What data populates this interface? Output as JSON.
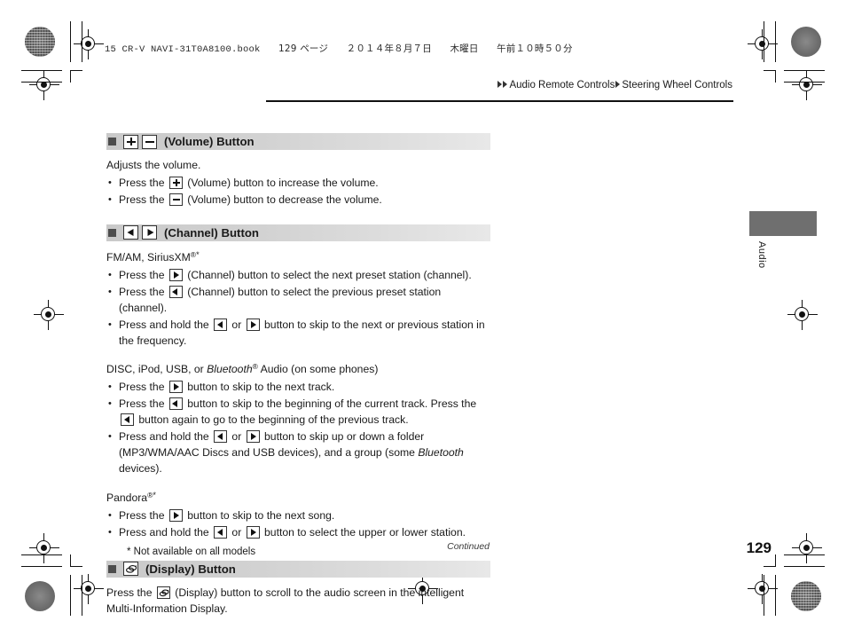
{
  "print_slug": {
    "text": "15 CR-V NAVI-31T0A8100.book",
    "page_label": "129 ページ",
    "date": "２０１４年８月７日",
    "weekday": "木曜日",
    "time": "午前１０時５０分"
  },
  "breadcrumb": {
    "parent": "Audio Remote Controls",
    "current": "Steering Wheel Controls"
  },
  "sections": [
    {
      "title": "(Volume) Button",
      "icons": [
        "plus-key-icon",
        "minus-key-icon"
      ],
      "intro": "Adjusts the volume.",
      "bullets": [
        {
          "before": "Press the ",
          "icon": "plus",
          "after": " (Volume) button to increase the volume."
        },
        {
          "before": "Press the ",
          "icon": "minus",
          "after": " (Volume) button to decrease the volume."
        }
      ]
    },
    {
      "title": "(Channel) Button",
      "icons": [
        "left-arrow-key-icon",
        "right-arrow-key-icon"
      ],
      "groups": [
        {
          "heading": "FM/AM, SiriusXM®*",
          "heading_base": "FM/AM, SiriusXM",
          "bullets": [
            "Press the [right] (Channel) button to select the next preset station (channel).",
            "Press the [left] (Channel) button to select the previous preset station (channel).",
            "Press and hold the [left] or [right] button to skip to the next or previous station in the frequency."
          ]
        },
        {
          "heading": "DISC, iPod, USB, or Bluetooth® Audio (on some phones)",
          "bullets": [
            "Press the [right] button to skip to the next track.",
            "Press the [left] button to skip to the beginning of the current track. Press the [left] button again to go to the beginning of the previous track.",
            "Press and hold the [left] or [right] button to skip up or down a folder (MP3/WMA/AAC Discs and USB devices), and a group (some Bluetooth devices)."
          ]
        },
        {
          "heading": "Pandora®*",
          "heading_base": "Pandora",
          "bullets": [
            "Press the [right] button to skip to the next song.",
            "Press and hold the [left] or [right] button to select the upper or lower station."
          ]
        }
      ]
    },
    {
      "title": "(Display) Button",
      "icons": [
        "display-key-icon"
      ],
      "body": "Press the [display] (Display) button to scroll to the audio screen in the intelligent Multi-Information Display."
    }
  ],
  "text": {
    "disc_heading_p1": "DISC, iPod, USB, or ",
    "disc_heading_bt": "Bluetooth",
    "disc_heading_p2": " Audio (on some phones)",
    "fmam_heading": "FM/AM, SiriusXM",
    "pandora_heading": "Pandora",
    "reg_mark": "®",
    "asterisk": "*",
    "press_the": "Press the ",
    "press_and_hold_the": "Press and hold the ",
    "or": " or ",
    "vol_increase": " (Volume) button to increase the volume.",
    "vol_decrease": " (Volume) button to decrease the volume.",
    "ch_next_preset": " (Channel) button to select the next preset station (channel).",
    "ch_prev_preset": " (Channel) button to select the previous preset station (channel).",
    "ch_skip_freq": " button to skip to the next or previous station in the frequency.",
    "disc_next_track": " button to skip to the next track.",
    "disc_cur_track_a": " button to skip to the beginning of the current track. Press the ",
    "disc_cur_track_b": " button again to go to the beginning of the previous track.",
    "disc_folder_a": " button to skip up or down a folder (MP3/WMA/AAC Discs and USB devices), and a group (some ",
    "disc_folder_bt": "Bluetooth",
    "disc_folder_b": " devices).",
    "pandora_next_song": " button to skip to the next song.",
    "pandora_station": " button to select the upper or lower station.",
    "display_body_a": "Press the ",
    "display_body_b": " (Display) button to scroll to the audio screen in the intelligent Multi-Information Display.",
    "volume_intro": "Adjusts the volume."
  },
  "side_tab": {
    "label": "Audio",
    "color": "#6f6f6f"
  },
  "footer": {
    "footnote": "* Not available on all models",
    "continued": "Continued",
    "page_number": "129"
  }
}
